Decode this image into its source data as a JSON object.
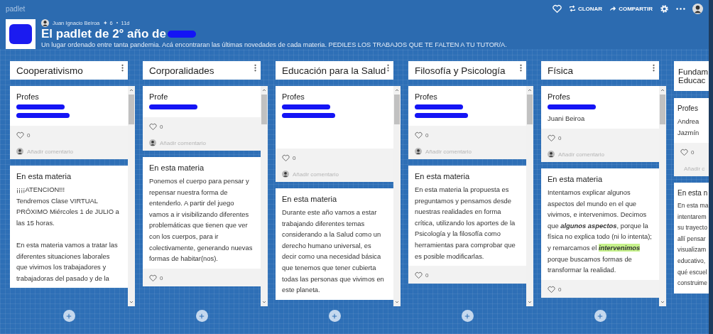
{
  "app": {
    "name": "padlet"
  },
  "toolbar": [
    {
      "kind": "heart"
    },
    {
      "kind": "clone",
      "label": "CLONAR"
    },
    {
      "kind": "share",
      "label": "COMPARTIR"
    },
    {
      "kind": "gear"
    },
    {
      "kind": "more"
    },
    {
      "kind": "avatar"
    }
  ],
  "board": {
    "author": "Juan Ignacio Beiroa",
    "reactions": "✦ 6",
    "age": "11d",
    "title": "El padlet de 2° año de",
    "title_redacted": true,
    "subtitle": "Un lugar ordenado entre tanta pandemia. Acá encontraran las últimas novedades de cada materia. PEDILES LOS TRABAJOS QUE TE FALTEN A TU TUTOR/A."
  },
  "columns": [
    {
      "title": [
        "Cooperativismo"
      ],
      "cut": false,
      "cards": [
        {
          "title": "Profes",
          "names": [
            {
              "kind": "redacted"
            },
            {
              "kind": "redacted"
            }
          ],
          "likes": "0",
          "comment_placeholder": "Añadir comentario"
        },
        {
          "title": "En esta materia",
          "body": [
            "¡¡¡¡ATENCION!!!",
            "Tendremos Clase VIRTUAL PRÓXIMO Miércoles 1 de JULIO a las 15 horas."
          ],
          "body_2": [
            "En esta materia vamos a tratar las diferentes situaciones laborales que vivimos los trabajadores y trabajadoras del pasado y de la"
          ]
        }
      ]
    },
    {
      "title": [
        "Corporalidades"
      ],
      "cut": false,
      "cards": [
        {
          "title": "Profe",
          "names": [
            {
              "kind": "redacted"
            }
          ],
          "likes": "0",
          "comment_placeholder": "Añadir comentario"
        },
        {
          "title": "En esta materia",
          "body": [
            "Ponemos el cuerpo para pensar y repensar nuestra forma de entenderlo. A partir del juego vamos a ir visibilizando diferentes problemáticas que tienen que ver con los cuerpos, para ir colectivamente, generando nuevas formas de habitar(nos)."
          ],
          "likes": "0"
        }
      ]
    },
    {
      "title": [
        "Educación para la Salud"
      ],
      "cut": false,
      "cards": [
        {
          "title": "Profes",
          "names": [
            {
              "kind": "redacted"
            },
            {
              "kind": "redacted"
            },
            {
              "kind": "blank"
            },
            {
              "kind": "blank"
            }
          ],
          "likes": "0",
          "comment_placeholder": "Añadir comentario"
        },
        {
          "title": "En esta materia",
          "body": [
            "Durante este año vamos a estar trabajando diferentes temas considerando a la Salud como un derecho humano universal, es decir como una necesidad básica que tenemos que tener cubierta todas las personas que vivimos en este planeta."
          ]
        }
      ]
    },
    {
      "title": [
        "Filosofía y Psicología"
      ],
      "cut": false,
      "cards": [
        {
          "title": "Profes",
          "names": [
            {
              "kind": "redacted"
            },
            {
              "kind": "redacted"
            }
          ],
          "likes": "0",
          "comment_placeholder": "Añadir comentario"
        },
        {
          "title": "En esta materia",
          "body": [
            "En esta materia la propuesta es preguntamos y pensamos desde nuestras realidades en forma crítica, utilizando los aportes de la Psicología y la filosofía como herramientas para comprobar que es posible modificarlas."
          ],
          "likes": "0"
        }
      ]
    },
    {
      "title": [
        "Física"
      ],
      "cut": false,
      "cards": [
        {
          "title": "Profes",
          "names": [
            {
              "kind": "redacted"
            },
            {
              "kind": "text",
              "text": "Juani Beiroa"
            }
          ],
          "likes": "0",
          "comment_placeholder": "Añadir comentario"
        },
        {
          "title": "En esta materia",
          "segments": [
            {
              "text": "Intentamos explicar algunos aspectos del mundo en el que vivimos, e intervenimos. Decimos que **algunos aspectos**, porque la física no explica todo (ni lo intenta); y remarcamos el",
              "highlighted": false
            },
            {
              "text": "**intervenimos**",
              "highlighted": true
            },
            {
              "text": "porque buscamos formas de transformar la realidad.",
              "highlighted": false
            }
          ],
          "likes": "0"
        }
      ]
    },
    {
      "title": [
        "Fundam",
        "Educac"
      ],
      "cut": true,
      "cards": [
        {
          "title": "Profes",
          "names": [
            {
              "kind": "text",
              "text": "Andrea"
            },
            {
              "kind": "text",
              "text": "Jazmín"
            }
          ],
          "likes": "0",
          "comment_placeholder": "Añadir c"
        },
        {
          "title": "En esta n",
          "body": [
            "En esta ma",
            "intentarem",
            "su trayecto",
            "allí pensar",
            "visualizam",
            "educativo,",
            "qué escuel",
            "construime"
          ]
        }
      ]
    }
  ]
}
